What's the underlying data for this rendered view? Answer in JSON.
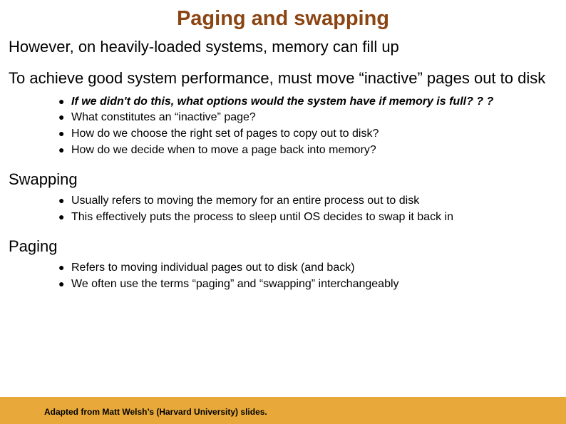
{
  "slide": {
    "title": "Paging and swapping",
    "para1": "However, on heavily-loaded systems, memory can fill up",
    "para2": "To achieve good system performance, must move “inactive” pages out to disk",
    "bulletsA": {
      "0": "If we didn't do this, what options would the system have if memory is full? ? ?",
      "1": "What constitutes an “inactive” page?",
      "2": "How do we choose the right set of pages to copy out to disk?",
      "3": "How do we decide when to move a page back into memory?"
    },
    "headingSwapping": "Swapping",
    "bulletsB": {
      "0": "Usually refers to moving the memory for an entire process out to disk",
      "1": "This effectively puts the process to sleep until OS decides to swap it back in"
    },
    "headingPaging": "Paging",
    "bulletsC": {
      "0": "Refers to moving individual pages out to disk (and back)",
      "1": "We often use the terms “paging” and “swapping” interchangeably"
    },
    "footer": "Adapted from Matt Welsh’s (Harvard University) slides."
  }
}
